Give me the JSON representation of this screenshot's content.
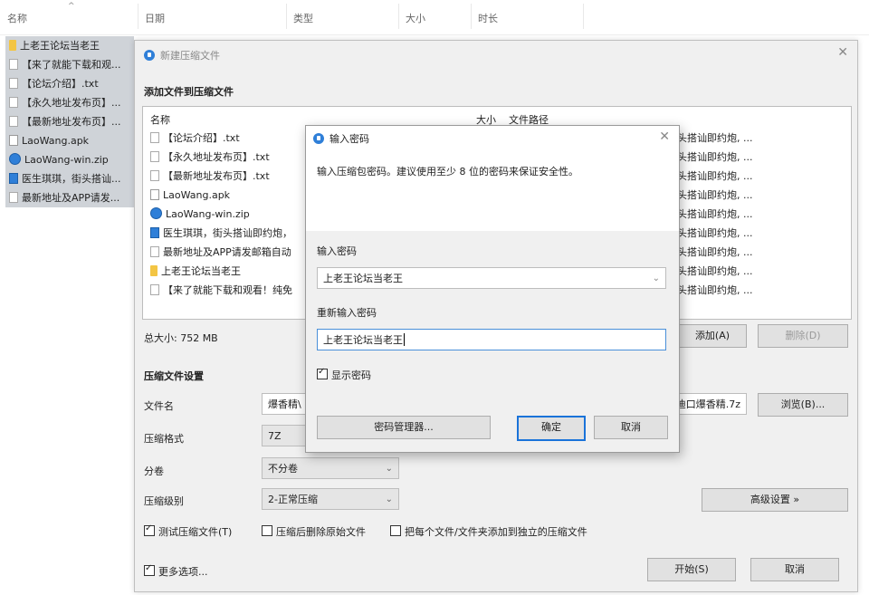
{
  "explorer": {
    "columns": [
      "名称",
      "日期",
      "类型",
      "大小",
      "时长"
    ],
    "rows": [
      {
        "icon": "folder",
        "name": "上老王论坛当老王"
      },
      {
        "icon": "file",
        "name": "【来了就能下载和观..."
      },
      {
        "icon": "file",
        "name": "【论坛介绍】.txt"
      },
      {
        "icon": "file",
        "name": "【永久地址发布页】..."
      },
      {
        "icon": "file",
        "name": "【最新地址发布页】..."
      },
      {
        "icon": "apk",
        "name": "LaoWang.apk"
      },
      {
        "icon": "zip",
        "name": "LaoWang-win.zip"
      },
      {
        "icon": "doc",
        "name": "医生琪琪，街头搭讪..."
      },
      {
        "icon": "file",
        "name": "最新地址及APP请发..."
      }
    ]
  },
  "main_dialog": {
    "title": "新建压缩文件",
    "add_section": "添加文件到压缩文件",
    "list_headers": {
      "name": "名称",
      "size": "大小",
      "path": "文件路径"
    },
    "files": [
      {
        "icon": "file",
        "name": "【论坛介绍】.txt"
      },
      {
        "icon": "file",
        "name": "【永久地址发布页】.txt"
      },
      {
        "icon": "file",
        "name": "【最新地址发布页】.txt"
      },
      {
        "icon": "apk",
        "name": "LaoWang.apk"
      },
      {
        "icon": "zip",
        "name": "LaoWang-win.zip"
      },
      {
        "icon": "doc",
        "name": "医生琪琪，街头搭讪即约炮，"
      },
      {
        "icon": "file",
        "name": "最新地址及APP请发邮箱自动"
      },
      {
        "icon": "folder",
        "name": "上老王论坛当老王"
      },
      {
        "icon": "file",
        "name": "【来了就能下载和观看！纯免"
      }
    ],
    "paths": [
      "头搭讪即约炮, ...",
      "头搭讪即约炮, ...",
      "头搭讪即约炮, ...",
      "头搭讪即约炮, ...",
      "头搭讪即约炮, ...",
      "头搭讪即约炮, ...",
      "头搭讪即约炮, ...",
      "头搭讪即约炮, ...",
      "头搭讪即约炮, ..."
    ],
    "total_size": "总大小: 752 MB",
    "add_button": "添加(A)",
    "remove_button": "删除(D)",
    "settings_section": "压缩文件设置",
    "filename_label": "文件名",
    "filename_value": "爆香精\\",
    "filename_tail": "迪口爆香精.7z",
    "browse_button": "浏览(B)...",
    "format_label": "压缩格式",
    "format_value": "7Z",
    "volume_label": "分卷",
    "volume_value": "不分卷",
    "level_label": "压缩级别",
    "level_value": "2-正常压缩",
    "advanced_button": "高级设置 »",
    "test_checkbox": "测试压缩文件(T)",
    "delete_checkbox": "压缩后删除原始文件",
    "each_checkbox": "把每个文件/文件夹添加到独立的压缩文件",
    "more_checkbox": "更多选项...",
    "start_button": "开始(S)",
    "cancel_button": "取消"
  },
  "password_dialog": {
    "title": "输入密码",
    "message": "输入压缩包密码。建议使用至少 8 位的密码来保证安全性。",
    "password_label": "输入密码",
    "password_value": "上老王论坛当老王",
    "confirm_label": "重新输入密码",
    "confirm_value": "上老王论坛当老王",
    "show_password": "显示密码",
    "manager_button": "密码管理器...",
    "ok_button": "确定",
    "cancel_button": "取消"
  }
}
